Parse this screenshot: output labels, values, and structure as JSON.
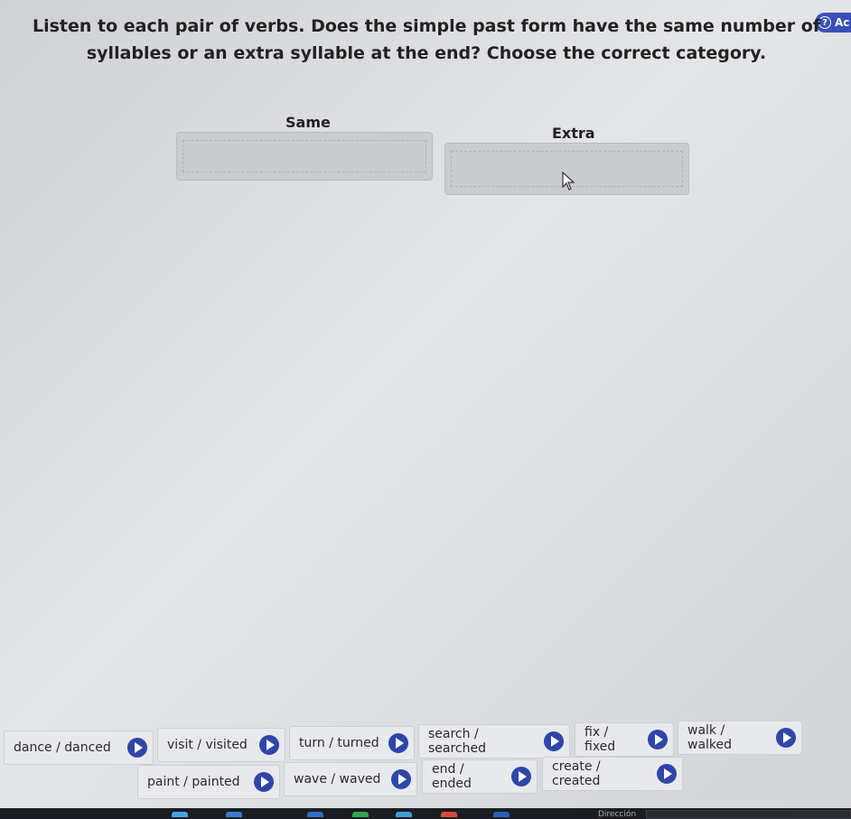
{
  "help": {
    "label": "Ac"
  },
  "instructions": "Listen to each pair of verbs. Does the simple past form have the same number of syllables or an extra syllable at the end? Choose the correct category.",
  "categories": [
    {
      "label": "Same"
    },
    {
      "label": "Extra"
    }
  ],
  "cards": [
    {
      "label": "dance / danced"
    },
    {
      "label": "visit / visited"
    },
    {
      "label": "turn / turned"
    },
    {
      "label": "search / searched"
    },
    {
      "label": "fix / fixed"
    },
    {
      "label": "walk / walked"
    },
    {
      "label": "paint / painted"
    },
    {
      "label": "wave / waved"
    },
    {
      "label": "end / ended"
    },
    {
      "label": "create / created"
    }
  ],
  "taskbar": {
    "address_label": "Dirección"
  },
  "colors": {
    "accent": "#2f46a8",
    "help_badge": "#3a4fb8"
  }
}
